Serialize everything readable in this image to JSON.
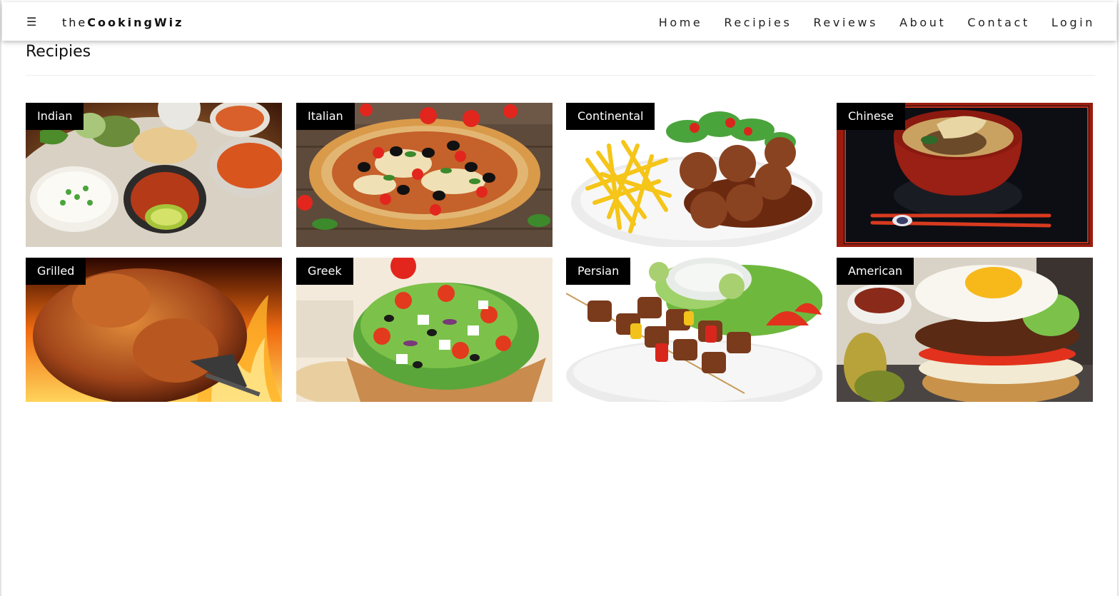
{
  "header": {
    "menu_icon": "☰",
    "brand_light": "the",
    "brand_bold": "CookingWiz",
    "nav": [
      "Home",
      "Recipies",
      "Reviews",
      "About",
      "Contact",
      "Login"
    ]
  },
  "page": {
    "title": "Recipies"
  },
  "recipes": [
    {
      "label": "Indian",
      "icon": "indian-thali-image"
    },
    {
      "label": "Italian",
      "icon": "pizza-image"
    },
    {
      "label": "Continental",
      "icon": "fries-meatballs-image"
    },
    {
      "label": "Chinese",
      "icon": "noodle-bowl-image"
    },
    {
      "label": "Grilled",
      "icon": "roast-chicken-image"
    },
    {
      "label": "Greek",
      "icon": "greek-salad-image"
    },
    {
      "label": "Persian",
      "icon": "kebab-image"
    },
    {
      "label": "American",
      "icon": "burger-image"
    }
  ]
}
